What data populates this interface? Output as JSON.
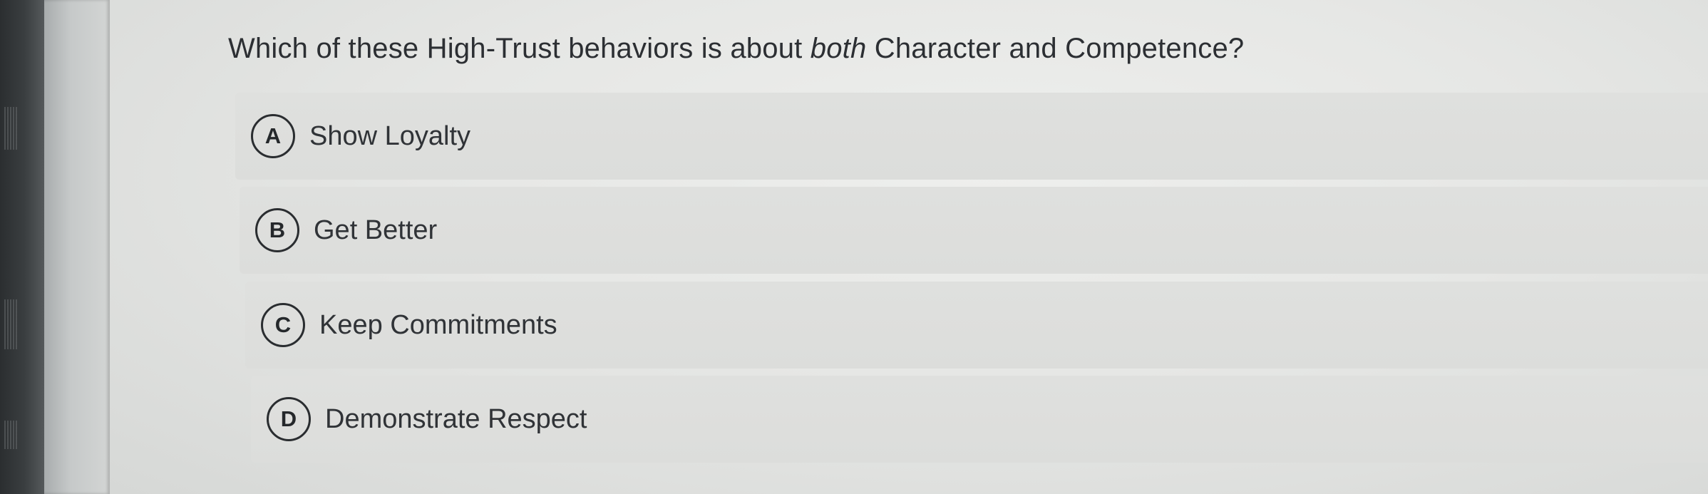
{
  "question": {
    "prefix": "Which of these High-Trust behaviors is about ",
    "emphasis": "both",
    "suffix": " Character and Competence?"
  },
  "choices": [
    {
      "letter": "A",
      "label": "Show Loyalty"
    },
    {
      "letter": "B",
      "label": "Get Better"
    },
    {
      "letter": "C",
      "label": "Keep Commitments"
    },
    {
      "letter": "D",
      "label": "Demonstrate Respect"
    }
  ]
}
